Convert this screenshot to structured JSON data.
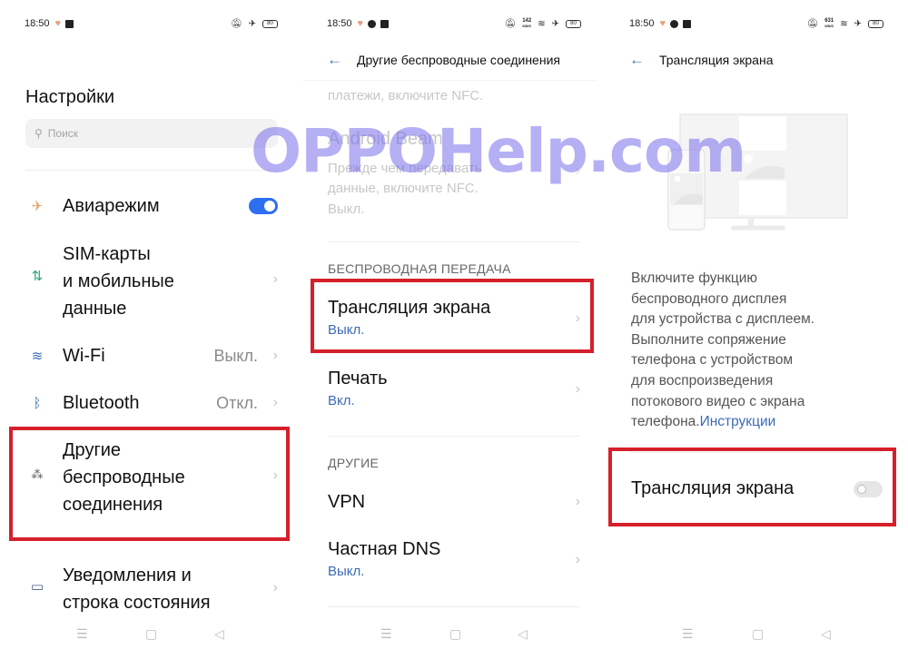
{
  "colors": {
    "accent": "#2e6ef0",
    "link": "#3c6bb8",
    "highlight_box": "#d5202a",
    "watermark": "#8a80ec"
  },
  "watermark": "OPPOHelp.com",
  "panels": [
    {
      "status_bar": {
        "time": "18:50",
        "battery": "80",
        "icons": [
          "heart-icon",
          "app-icon",
          "mute-icon",
          "airplane-icon",
          "battery-icon"
        ]
      },
      "title": "Настройки",
      "search": {
        "placeholder": "Поиск",
        "icon": "search-icon"
      },
      "items": [
        {
          "icon": "airplane-icon",
          "label": "Авиарежим",
          "toggle": true
        },
        {
          "icon": "mobile-data-icon",
          "label": "SIM-карты\nи мобильные\nданные"
        },
        {
          "icon": "wifi-icon",
          "label": "Wi-Fi",
          "value": "Выкл."
        },
        {
          "icon": "bluetooth-icon",
          "label": "Bluetooth",
          "value": "Откл."
        },
        {
          "icon": "connections-icon",
          "label": "Другие\nбеспроводные\nсоединения",
          "highlighted": true
        },
        {
          "icon": "notifications-icon",
          "label": "Уведомления и\nстрока состояния"
        }
      ]
    },
    {
      "status_bar": {
        "time": "18:50",
        "battery": "80",
        "net_speed": "142",
        "net_unit": "KB/S",
        "icons": [
          "heart-icon",
          "circle-icon",
          "app-icon",
          "mute-icon",
          "wifi-icon",
          "airplane-icon",
          "battery-icon"
        ]
      },
      "title": "Другие беспроводные соединения",
      "faded": {
        "nfc_desc_tail": "платежи, включите NFC.",
        "beam_title": "Android Beam",
        "beam_desc1": "Прежде чем передавать",
        "beam_desc2": "данные, включите NFC.",
        "beam_value": "Выкл."
      },
      "sections": [
        {
          "header": "БЕСПРОВОДНАЯ ПЕРЕДАЧА",
          "items": [
            {
              "label": "Трансляция экрана",
              "value": "Выкл.",
              "highlighted": true
            },
            {
              "label": "Печать",
              "value": "Вкл."
            }
          ]
        },
        {
          "header": "ДРУГИЕ",
          "items": [
            {
              "label": "VPN"
            },
            {
              "label": "Частная DNS",
              "value": "Выкл."
            }
          ]
        }
      ]
    },
    {
      "status_bar": {
        "time": "18:50",
        "battery": "80",
        "net_speed": "631",
        "net_unit": "KB/S"
      },
      "title": "Трансляция экрана",
      "description": "Включите функцию беспроводного дисплея для устройства с дисплеем. Выполните сопряжение телефона с устройством для воспроизведения потокового видео с экрана телефона.",
      "description_lines": [
        "Включите функцию",
        "беспроводного дисплея",
        "для устройства с дисплеем.",
        "Выполните сопряжение",
        "телефона с устройством",
        "для воспроизведения",
        "потокового видео с экрана",
        "телефона."
      ],
      "link": "Инструкции",
      "toggle_label": "Трансляция экрана",
      "toggle_on": false
    }
  ],
  "navbar": {
    "menu": "☰",
    "home": "▢",
    "back": "◁"
  }
}
